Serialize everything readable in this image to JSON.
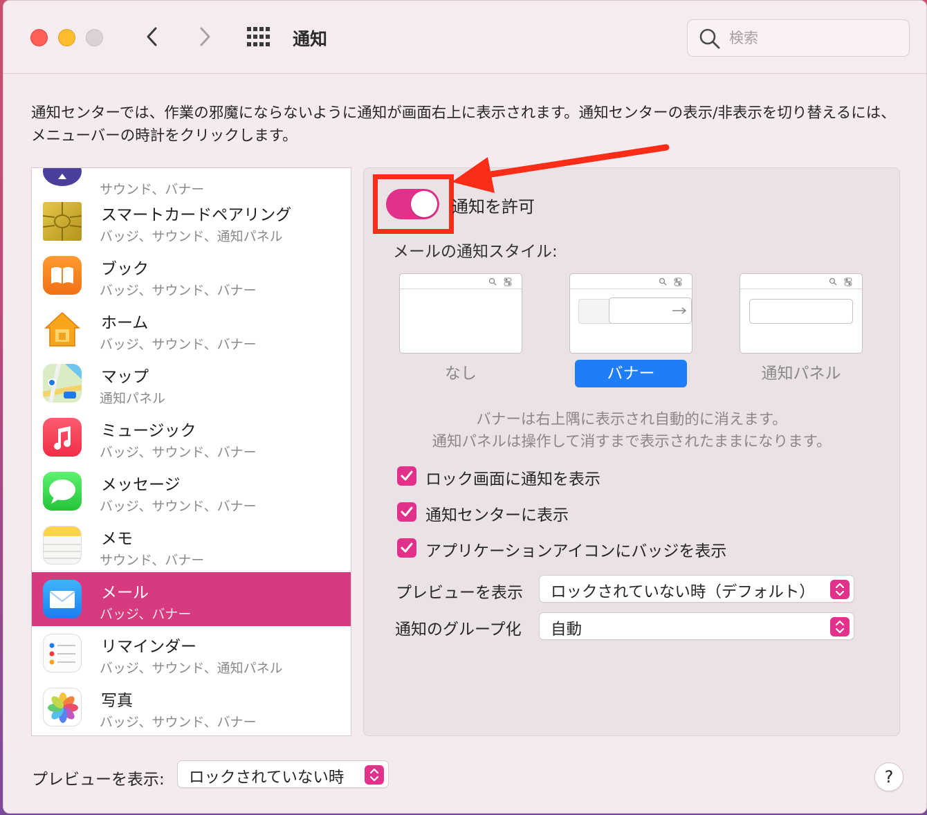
{
  "window": {
    "title": "通知"
  },
  "search": {
    "placeholder": "検索"
  },
  "description": "通知センターでは、作業の邪魔にならないように通知が画面右上に表示されます。通知センターの表示/非表示を切り替えるには、メニューバーの時計をクリックします。",
  "apps": [
    {
      "name": "",
      "sub": "サウンド、バナー",
      "icon": "unknown-app-icon"
    },
    {
      "name": "スマートカードペアリング",
      "sub": "バッジ、サウンド、通知パネル",
      "icon": "smartcard-icon"
    },
    {
      "name": "ブック",
      "sub": "バッジ、サウンド、バナー",
      "icon": "books-icon"
    },
    {
      "name": "ホーム",
      "sub": "バッジ、サウンド、バナー",
      "icon": "home-icon"
    },
    {
      "name": "マップ",
      "sub": "通知パネル",
      "icon": "maps-icon"
    },
    {
      "name": "ミュージック",
      "sub": "バッジ、サウンド、バナー",
      "icon": "music-icon"
    },
    {
      "name": "メッセージ",
      "sub": "バッジ、サウンド、バナー",
      "icon": "messages-icon"
    },
    {
      "name": "メモ",
      "sub": "サウンド、バナー",
      "icon": "notes-icon"
    },
    {
      "name": "メール",
      "sub": "バッジ、バナー",
      "icon": "mail-icon",
      "selected": true
    },
    {
      "name": "リマインダー",
      "sub": "バッジ、サウンド、通知パネル",
      "icon": "reminders-icon"
    },
    {
      "name": "写真",
      "sub": "バッジ、サウンド、バナー",
      "icon": "photos-icon"
    }
  ],
  "panel": {
    "allow_label": "通知を許可",
    "allow_enabled": true,
    "style_label": "メールの通知スタイル:",
    "styles": [
      {
        "label": "なし",
        "selected": false
      },
      {
        "label": "バナー",
        "selected": true
      },
      {
        "label": "通知パネル",
        "selected": false
      }
    ],
    "explain_line1": "バナーは右上隅に表示され自動的に消えます。",
    "explain_line2": "通知パネルは操作して消すまで表示されたままになります。",
    "checks": [
      {
        "label": "ロック画面に通知を表示",
        "checked": true
      },
      {
        "label": "通知センターに表示",
        "checked": true
      },
      {
        "label": "アプリケーションアイコンにバッジを表示",
        "checked": true
      }
    ],
    "preview_label": "プレビューを表示",
    "preview_value": "ロックされていない時（デフォルト）",
    "grouping_label": "通知のグループ化",
    "grouping_value": "自動"
  },
  "footer": {
    "preview_label": "プレビューを表示:",
    "preview_value": "ロックされていない時",
    "help": "?"
  },
  "colors": {
    "accent": "#e2318a",
    "selected_row": "#d63b80",
    "highlight": "#fb2d19",
    "banner_selected": "#1f7df5"
  }
}
